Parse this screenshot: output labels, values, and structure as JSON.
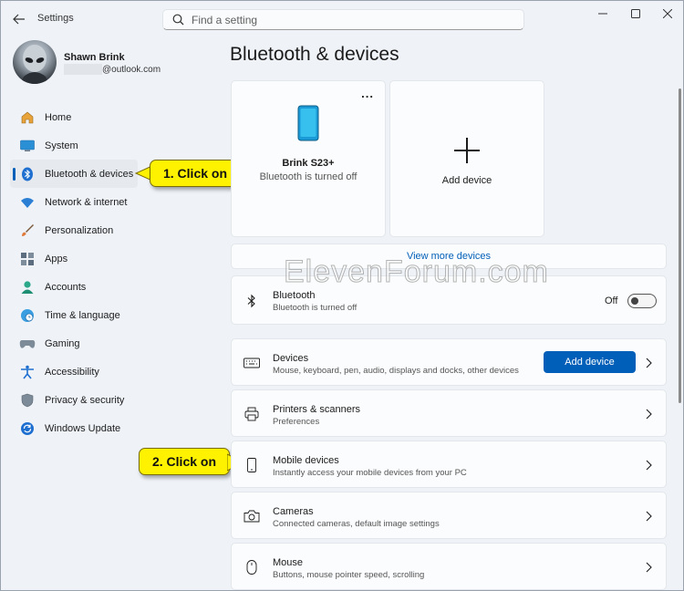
{
  "window": {
    "title": "Settings",
    "search_placeholder": "Find a setting"
  },
  "profile": {
    "name": "Shawn Brink",
    "email_suffix": "@outlook.com"
  },
  "sidebar": {
    "items": [
      {
        "label": "Home",
        "icon": "home-icon",
        "active": false
      },
      {
        "label": "System",
        "icon": "system-icon",
        "active": false
      },
      {
        "label": "Bluetooth & devices",
        "icon": "bluetooth-icon",
        "active": true
      },
      {
        "label": "Network & internet",
        "icon": "wifi-icon",
        "active": false
      },
      {
        "label": "Personalization",
        "icon": "brush-icon",
        "active": false
      },
      {
        "label": "Apps",
        "icon": "apps-icon",
        "active": false
      },
      {
        "label": "Accounts",
        "icon": "person-icon",
        "active": false
      },
      {
        "label": "Time & language",
        "icon": "globe-clock-icon",
        "active": false
      },
      {
        "label": "Gaming",
        "icon": "gamepad-icon",
        "active": false
      },
      {
        "label": "Accessibility",
        "icon": "accessibility-icon",
        "active": false
      },
      {
        "label": "Privacy & security",
        "icon": "shield-icon",
        "active": false
      },
      {
        "label": "Windows Update",
        "icon": "update-icon",
        "active": false
      }
    ]
  },
  "callouts": {
    "first": "1. Click on",
    "second": "2. Click on"
  },
  "main": {
    "title": "Bluetooth & devices",
    "device_card": {
      "name": "Brink S23+",
      "status": "Bluetooth is turned off",
      "menu": "..."
    },
    "add_card": {
      "label": "Add device",
      "symbol": "+"
    },
    "view_more": "View more devices",
    "bluetooth": {
      "title": "Bluetooth",
      "sub": "Bluetooth is turned off",
      "state": "Off"
    },
    "rows": [
      {
        "title": "Devices",
        "sub": "Mouse, keyboard, pen, audio, displays and docks, other devices",
        "icon": "keyboard-icon",
        "button": "Add device"
      },
      {
        "title": "Printers & scanners",
        "sub": "Preferences",
        "icon": "printer-icon"
      },
      {
        "title": "Mobile devices",
        "sub": "Instantly access your mobile devices from your PC",
        "icon": "phone-icon"
      },
      {
        "title": "Cameras",
        "sub": "Connected cameras, default image settings",
        "icon": "camera-icon"
      },
      {
        "title": "Mouse",
        "sub": "Buttons, mouse pointer speed, scrolling",
        "icon": "mouse-icon"
      }
    ]
  },
  "watermark": "ElevenForum.com",
  "colors": {
    "accent": "#005fb8",
    "callout": "#fff200",
    "background": "#eff3f8"
  }
}
